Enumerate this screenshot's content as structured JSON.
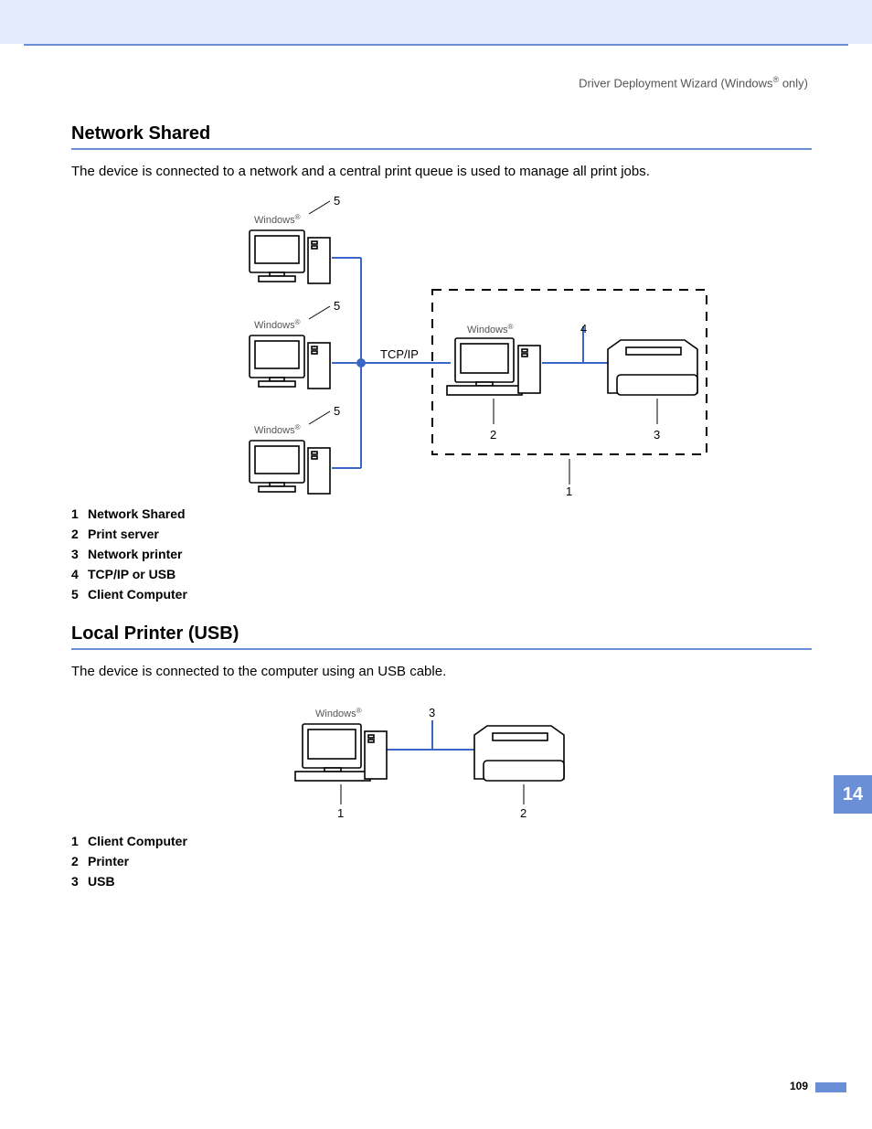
{
  "header": {
    "breadcrumb_prefix": "Driver Deployment Wizard (Windows",
    "breadcrumb_suffix": " only)",
    "reg": "®"
  },
  "section1": {
    "title": "Network Shared",
    "body": "The device is connected to a network and a central print queue is used to manage all print jobs.",
    "legend": [
      {
        "n": "1",
        "t": "Network Shared"
      },
      {
        "n": "2",
        "t": "Print server"
      },
      {
        "n": "3",
        "t": "Network printer"
      },
      {
        "n": "4",
        "t": "TCP/IP or USB"
      },
      {
        "n": "5",
        "t": "Client Computer"
      }
    ],
    "diagram": {
      "windows_label": "Windows",
      "reg": "®",
      "tcpip": "TCP/IP",
      "c5": "5",
      "c4": "4",
      "c3": "3",
      "c2": "2",
      "c1": "1"
    }
  },
  "section2": {
    "title": "Local Printer (USB)",
    "body": "The device is connected to the computer using an USB cable.",
    "legend": [
      {
        "n": "1",
        "t": "Client Computer"
      },
      {
        "n": "2",
        "t": "Printer"
      },
      {
        "n": "3",
        "t": "USB"
      }
    ],
    "diagram": {
      "windows_label": "Windows",
      "reg": "®",
      "c3": "3",
      "c2": "2",
      "c1": "1"
    }
  },
  "chapter_tab": "14",
  "page_number": "109"
}
